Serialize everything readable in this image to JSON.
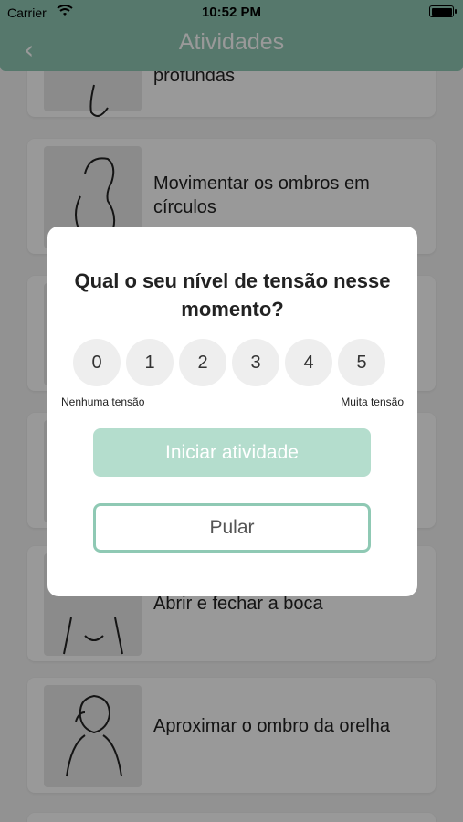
{
  "status_bar": {
    "carrier": "Carrier",
    "time": "10:52 PM"
  },
  "nav": {
    "back_icon": "chevron-left-icon",
    "title": "Atividades"
  },
  "activities": [
    {
      "label": "profundas"
    },
    {
      "label": "Movimentar os ombros em círculos"
    },
    {
      "label": ""
    },
    {
      "label": ""
    },
    {
      "label": "Abrir e fechar a boca"
    },
    {
      "label": "Aproximar o ombro da orelha"
    }
  ],
  "modal": {
    "question": "Qual o seu nível de tensão nesse momento?",
    "scale": [
      "0",
      "1",
      "2",
      "3",
      "4",
      "5"
    ],
    "scale_min_label": "Nenhuma tensão",
    "scale_max_label": "Muita tensão",
    "start_button": "Iniciar atividade",
    "skip_button": "Pular"
  },
  "colors": {
    "accent": "#8fc9b4",
    "start_button": "#b4ddcd",
    "overlay": "rgba(0,0,0,0.4)"
  }
}
